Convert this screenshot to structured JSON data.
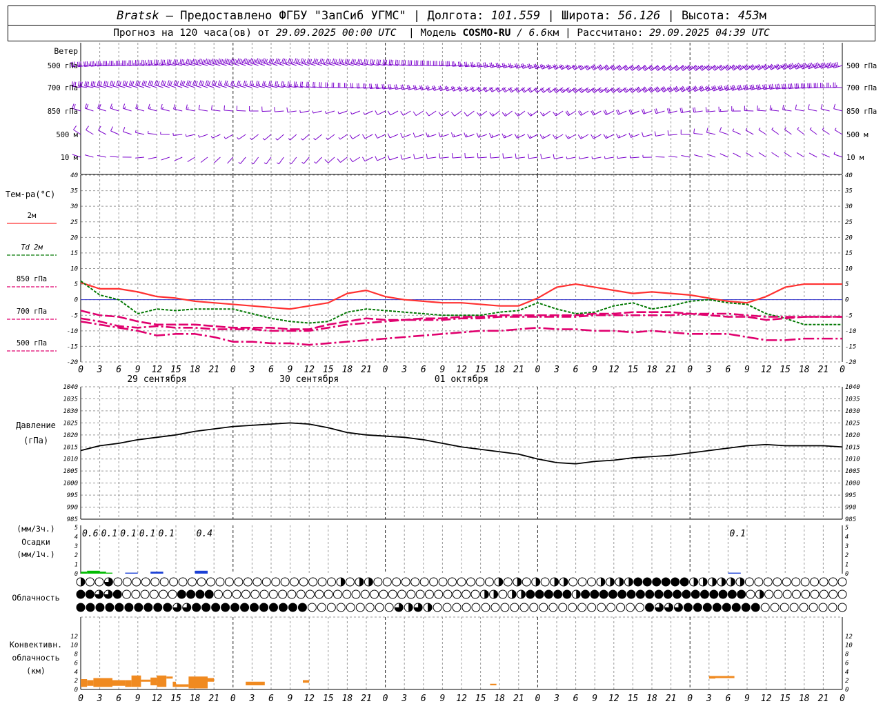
{
  "header": {
    "station": "Bratsk",
    "provider": " — Предоставлено ФГБУ \"ЗапСиб УГМС\" | ",
    "lon_label": "Долгота: ",
    "lon": "101.559",
    "lat_label": " | Широта: ",
    "lat": "56.126",
    "alt_label": " | Высота: ",
    "alt": "453",
    "alt_unit": "м",
    "forecast_label": "Прогноз на 120 часа(ов) от ",
    "forecast_from": "29.09.2025 00:00 UTC",
    "model_label": "  | Модель ",
    "model": "COSMO-RU",
    "model_res": " / 6.6",
    "model_res_unit": "км",
    "calc_label": " | Рассчитано: ",
    "calc_time": "29.09.2025 04:39 UTC"
  },
  "colors": {
    "t2m": "#ff3030",
    "td2m": "#007700",
    "t850": "#e0006e",
    "t700": "#e0006e",
    "t500": "#e0006e",
    "pressure": "#000000",
    "precip_green": "#00bb00",
    "precip_blue": "#1a3fd6",
    "convective": "#f08a20",
    "wind": "#7a00cc",
    "zero_line": "#3333cc",
    "grid": "#999999"
  },
  "chart_data": [
    {
      "type": "wind_barbs",
      "title": "Ветер",
      "levels": [
        "500 гПа",
        "700 гПа",
        "850 гПа",
        "500 м",
        "10  м"
      ]
    },
    {
      "type": "line",
      "title": "Тем-ра(°C)",
      "ylim": [
        -20,
        40
      ],
      "yticks": [
        40,
        35,
        30,
        25,
        20,
        15,
        10,
        5,
        0,
        -5,
        -10,
        -15,
        -20
      ],
      "x_hours": [
        0,
        3,
        6,
        9,
        12,
        15,
        18,
        21,
        24,
        27,
        30,
        33,
        36,
        39,
        42,
        45,
        48,
        51,
        54,
        57,
        60,
        63,
        66,
        69,
        72,
        75,
        78,
        81,
        84,
        87,
        90,
        93,
        96,
        99,
        102,
        105,
        108,
        111,
        114,
        117,
        120
      ],
      "x_tick_labels": [
        "0",
        "3",
        "6",
        "9",
        "12",
        "15",
        "18",
        "21",
        "0",
        "3",
        "6",
        "9",
        "12",
        "15",
        "18",
        "21",
        "0",
        "3",
        "6",
        "9",
        "12",
        "15",
        "18",
        "21",
        "0",
        "3",
        "6"
      ],
      "date_labels": [
        "29 сентября",
        "30 сентября",
        "01 октября"
      ],
      "series": [
        {
          "name": "2м",
          "values": [
            5.5,
            3.5,
            3.5,
            2.5,
            1,
            0.5,
            -0.5,
            -1,
            -1.5,
            -2,
            -2.5,
            -3,
            -2,
            -1,
            2,
            3,
            1,
            0,
            -0.5,
            -1,
            -1,
            -1.5,
            -2,
            -2,
            0.5,
            4,
            5,
            4,
            3,
            2,
            2.5,
            2,
            1.5,
            0.5,
            -0.5,
            -1,
            1,
            4,
            5,
            5,
            5
          ]
        },
        {
          "name": "Td  2м",
          "values": [
            6,
            1.5,
            0,
            -4.5,
            -3,
            -3.5,
            -3,
            -3,
            -3,
            -4.5,
            -6,
            -7,
            -7.5,
            -7,
            -4,
            -3,
            -3.5,
            -4,
            -4.5,
            -5,
            -5,
            -5,
            -4,
            -3.5,
            -1,
            -3,
            -4.5,
            -4,
            -2,
            -1,
            -3,
            -2,
            -0.5,
            0,
            -1,
            -1.5,
            -4.5,
            -6,
            -8,
            -8,
            -8
          ]
        },
        {
          "name": "850  гПа",
          "values": [
            -3.5,
            -5,
            -5.5,
            -7,
            -8,
            -8,
            -8,
            -8.5,
            -9,
            -9,
            -9,
            -9.5,
            -9.5,
            -8,
            -7,
            -6,
            -6.5,
            -6.5,
            -6,
            -6,
            -5.5,
            -5.5,
            -5,
            -5,
            -5,
            -5,
            -5,
            -4.5,
            -4.5,
            -4,
            -4,
            -4,
            -4.5,
            -5,
            -5.5,
            -5.5,
            -6.5,
            -6,
            -5.5,
            -5.5,
            -5.5
          ]
        },
        {
          "name": "700  гПа",
          "values": [
            -6,
            -7,
            -8.5,
            -9,
            -8.5,
            -9,
            -9,
            -9.5,
            -9.5,
            -9.5,
            -10,
            -10,
            -10,
            -9,
            -8,
            -7.5,
            -7,
            -6.5,
            -6.5,
            -6.5,
            -6,
            -6,
            -5.5,
            -5.5,
            -5.5,
            -5.5,
            -5.5,
            -5,
            -5,
            -5,
            -5,
            -5,
            -4.5,
            -4.5,
            -4.5,
            -5,
            -5.5,
            -5.5,
            -5.5,
            -5.5,
            -5.5
          ]
        },
        {
          "name": "500  гПа",
          "values": [
            -7,
            -8,
            -9,
            -10,
            -11.5,
            -11,
            -11,
            -12,
            -13.5,
            -13.5,
            -14,
            -14,
            -14.5,
            -14,
            -13.5,
            -13,
            -12.5,
            -12,
            -11.5,
            -11,
            -10.5,
            -10,
            -10,
            -9.5,
            -9,
            -9.5,
            -9.5,
            -10,
            -10,
            -10.5,
            -10,
            -10.5,
            -11,
            -11,
            -11,
            -12,
            -13,
            -13,
            -12.5,
            -12.5,
            -12.5
          ]
        }
      ]
    },
    {
      "type": "line",
      "title": "Давление",
      "ylabel": "(гПа)",
      "ylim": [
        985,
        1040
      ],
      "yticks": [
        1040,
        1035,
        1030,
        1025,
        1020,
        1015,
        1010,
        1005,
        1000,
        995,
        990,
        985
      ],
      "series": [
        {
          "name": "",
          "values": [
            1013.5,
            1015.5,
            1016.5,
            1018,
            1019,
            1020,
            1021.5,
            1022.5,
            1023.5,
            1024,
            1024.5,
            1025,
            1024.5,
            1023,
            1021,
            1020,
            1019.5,
            1019,
            1018,
            1016.5,
            1015,
            1014,
            1013,
            1012,
            1010,
            1008.5,
            1008,
            1009,
            1009.5,
            1010.5,
            1011,
            1011.5,
            1012.5,
            1013.5,
            1014.5,
            1015.5,
            1016,
            1015.5,
            1015.5,
            1015.5,
            1015
          ]
        }
      ]
    },
    {
      "type": "bar",
      "title": "Осадки",
      "ylabel_3h": "(мм/3ч.)",
      "ylabel_1h": "(мм/1ч.)",
      "ylim": [
        0,
        5
      ],
      "yticks": [
        5,
        4,
        3,
        2,
        1,
        0
      ],
      "labels": [
        {
          "hour": 1.5,
          "text": "0.6"
        },
        {
          "hour": 4.5,
          "text": "0.1"
        },
        {
          "hour": 7.5,
          "text": "0.1"
        },
        {
          "hour": 10.5,
          "text": "0.1"
        },
        {
          "hour": 13.5,
          "text": "0.1"
        },
        {
          "hour": 19.5,
          "text": "0.4"
        },
        {
          "hour": 103.5,
          "text": "0.1"
        }
      ],
      "bars": [
        {
          "start": 0,
          "end": 1,
          "value": 0.2,
          "kind": "green"
        },
        {
          "start": 1,
          "end": 3,
          "value": 0.3,
          "kind": "green"
        },
        {
          "start": 3,
          "end": 4,
          "value": 0.2,
          "kind": "green"
        },
        {
          "start": 4,
          "end": 5,
          "value": 0.1,
          "kind": "green"
        },
        {
          "start": 7,
          "end": 9,
          "value": 0.1,
          "kind": "blue"
        },
        {
          "start": 11,
          "end": 13,
          "value": 0.2,
          "kind": "blue"
        },
        {
          "start": 18,
          "end": 20,
          "value": 0.3,
          "kind": "blue"
        },
        {
          "start": 102,
          "end": 104,
          "value": 0.1,
          "kind": "blue"
        }
      ]
    },
    {
      "type": "cloud_symbols",
      "title": "Облачность",
      "rows": [
        "HEEQEEEEEEEEEEEEEEEEEEEEEEEEHEHHEEEEEEEEEEEEEHEHEHEHHEEEHHHHFFFFFFHHHHHHEEEEEEEEEEE",
        "FFQQFEEEEEEFFFFEEEEEEEEEEEEEEEEEEEEEEEEEEEEEHHEHHFFFFFHFFFFFFFFFFFFFFFFFFEHEEEEEEEEE",
        "FFFFFFFFFFQQFFFFFFFFFFFFEEEEEEEEEQHQHEEEEEEEEEEEEEEEEEEEEEEFQQQFFFFFFFFEEEEEEEEE"
      ]
    },
    {
      "type": "bar",
      "title": "Конвективн.",
      "title2": "облачность",
      "ylabel": "(км)",
      "ylim": [
        0,
        14
      ],
      "yticks": [
        12,
        10,
        8,
        6,
        4,
        2,
        0
      ],
      "bars": [
        {
          "start": 0,
          "end": 1,
          "bottom": 0.5,
          "top": 2
        },
        {
          "start": 1,
          "end": 2,
          "bottom": 0.7,
          "top": 1.8
        },
        {
          "start": 2,
          "end": 5,
          "bottom": 0.5,
          "top": 2.2
        },
        {
          "start": 5,
          "end": 7,
          "bottom": 0.7,
          "top": 1.8
        },
        {
          "start": 7,
          "end": 8,
          "bottom": 0.5,
          "top": 1.8
        },
        {
          "start": 8,
          "end": 9.5,
          "bottom": 0.5,
          "top": 2.7
        },
        {
          "start": 9.5,
          "end": 11,
          "bottom": 1.5,
          "top": 1.9
        },
        {
          "start": 11,
          "end": 12,
          "bottom": 0.8,
          "top": 2.3
        },
        {
          "start": 12,
          "end": 13.5,
          "bottom": 0.5,
          "top": 2.7
        },
        {
          "start": 13.5,
          "end": 14.5,
          "bottom": 2.1,
          "top": 2.5
        },
        {
          "start": 14.5,
          "end": 15,
          "bottom": 0.5,
          "top": 1.5
        },
        {
          "start": 15,
          "end": 17,
          "bottom": 0.5,
          "top": 1
        },
        {
          "start": 17,
          "end": 20,
          "bottom": 0.2,
          "top": 2.5
        },
        {
          "start": 20,
          "end": 21,
          "bottom": 1.5,
          "top": 2.2
        },
        {
          "start": 26,
          "end": 29,
          "bottom": 0.8,
          "top": 1.5
        },
        {
          "start": 35,
          "end": 36,
          "bottom": 1.3,
          "top": 1.8
        },
        {
          "start": 64.5,
          "end": 65.5,
          "bottom": 0.8,
          "top": 1.1
        },
        {
          "start": 99,
          "end": 100,
          "bottom": 2.1,
          "top": 2.6
        },
        {
          "start": 100,
          "end": 103,
          "bottom": 2.2,
          "top": 2.6
        }
      ]
    }
  ]
}
